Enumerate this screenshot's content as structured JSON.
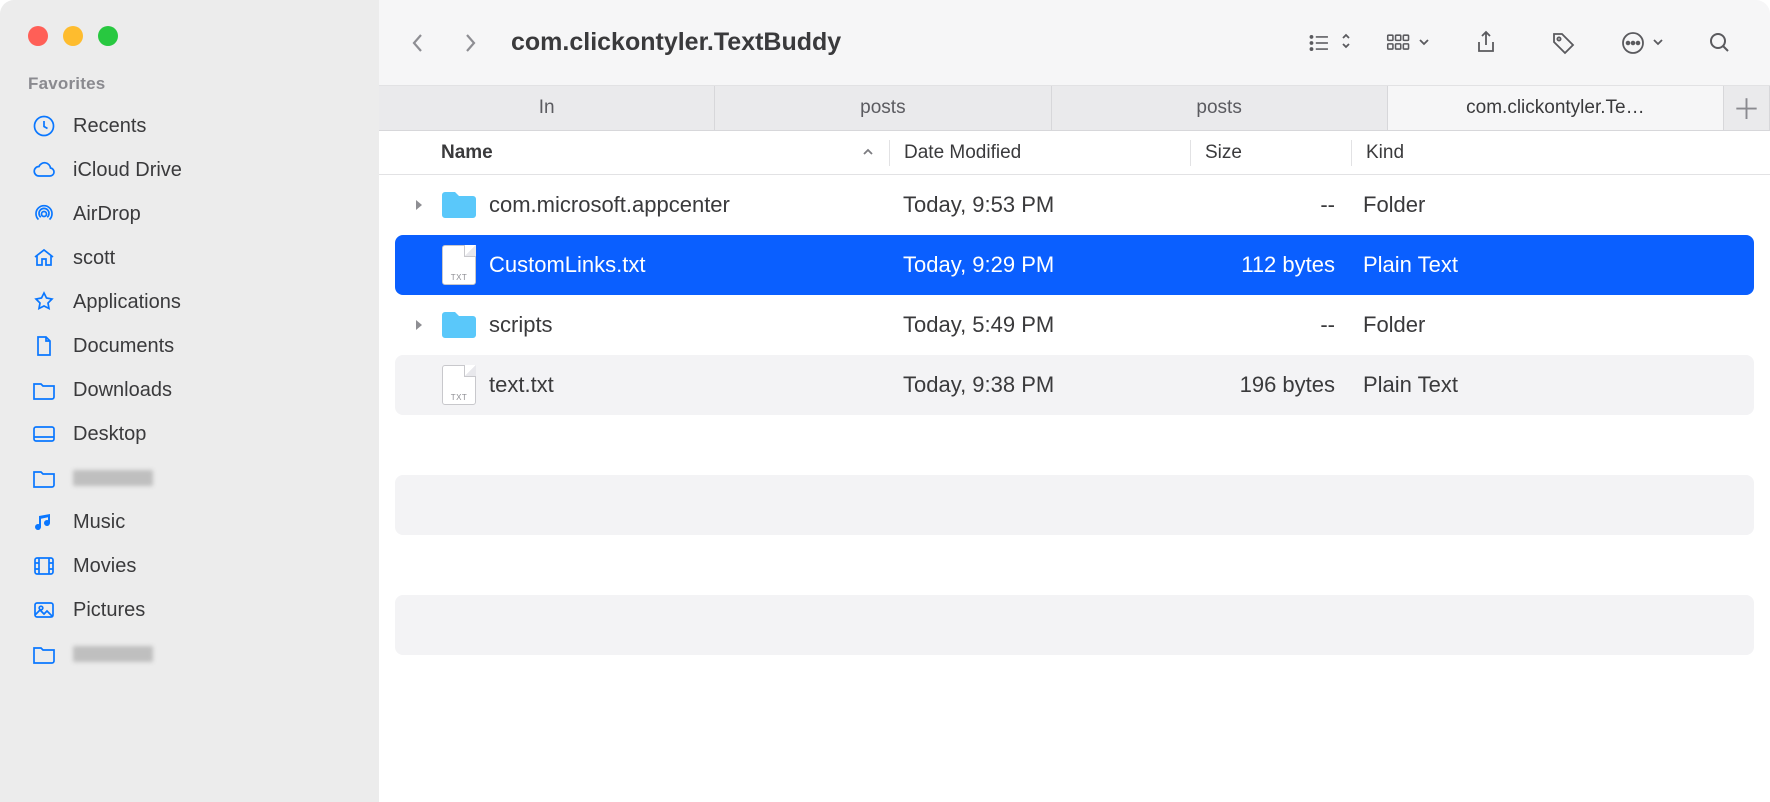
{
  "window": {
    "title": "com.clickontyler.TextBuddy"
  },
  "sidebar": {
    "section_label": "Favorites",
    "items": [
      {
        "icon": "clock",
        "label": "Recents"
      },
      {
        "icon": "cloud",
        "label": "iCloud Drive"
      },
      {
        "icon": "airdrop",
        "label": "AirDrop"
      },
      {
        "icon": "house",
        "label": "scott"
      },
      {
        "icon": "app",
        "label": "Applications"
      },
      {
        "icon": "doc",
        "label": "Documents"
      },
      {
        "icon": "folder",
        "label": "Downloads"
      },
      {
        "icon": "desktop",
        "label": "Desktop"
      },
      {
        "icon": "folder",
        "label": ""
      },
      {
        "icon": "music",
        "label": "Music"
      },
      {
        "icon": "film",
        "label": "Movies"
      },
      {
        "icon": "photo",
        "label": "Pictures"
      },
      {
        "icon": "folder",
        "label": ""
      }
    ]
  },
  "tabs": [
    {
      "label": "In",
      "active": false
    },
    {
      "label": "posts",
      "active": false
    },
    {
      "label": "posts",
      "active": false
    },
    {
      "label": "com.clickontyler.Te…",
      "active": true
    }
  ],
  "columns": {
    "name": "Name",
    "date": "Date Modified",
    "size": "Size",
    "kind": "Kind"
  },
  "files": [
    {
      "type": "folder",
      "name": "com.microsoft.appcenter",
      "date": "Today, 9:53 PM",
      "size": "--",
      "kind": "Folder",
      "selected": false,
      "expandable": true
    },
    {
      "type": "txt",
      "name": "CustomLinks.txt",
      "date": "Today, 9:29 PM",
      "size": "112 bytes",
      "kind": "Plain Text",
      "selected": true,
      "expandable": false
    },
    {
      "type": "folder",
      "name": "scripts",
      "date": "Today, 5:49 PM",
      "size": "--",
      "kind": "Folder",
      "selected": false,
      "expandable": true
    },
    {
      "type": "txt",
      "name": "text.txt",
      "date": "Today, 9:38 PM",
      "size": "196 bytes",
      "kind": "Plain Text",
      "selected": false,
      "expandable": false
    }
  ]
}
